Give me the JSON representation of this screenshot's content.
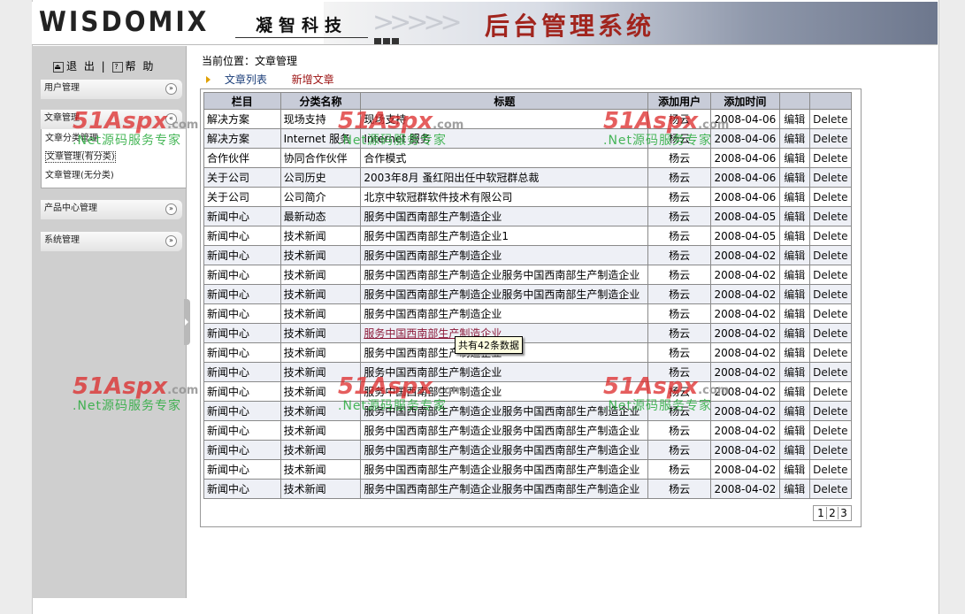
{
  "header": {
    "logo": "WISDOMIX",
    "logo_sub": "凝智科技",
    "title": "后台管理系统"
  },
  "sidebar": {
    "logout": "退 出",
    "help": "帮 助",
    "menus": [
      {
        "label": "用户管理"
      },
      {
        "label": "文章管理"
      },
      {
        "label": "产品中心管理"
      },
      {
        "label": "系统管理"
      }
    ],
    "article_sub": [
      "文章分类管理",
      "文章管理(有分类)",
      "文章管理(无分类)"
    ]
  },
  "main": {
    "breadcrumb": "当前位置：文章管理",
    "tab_list": "文章列表",
    "tab_add": "新增文章"
  },
  "table": {
    "headers": [
      "栏目",
      "分类名称",
      "标题",
      "添加用户",
      "添加时间",
      "",
      ""
    ],
    "edit_label": "编辑",
    "delete_label": "Delete",
    "rows": [
      [
        "解决方案",
        "现场支持",
        "现场支持",
        "杨云",
        "2008-04-06"
      ],
      [
        "解决方案",
        "Internet 服务",
        "Internet 服务",
        "杨云",
        "2008-04-06"
      ],
      [
        "合作伙伴",
        "协同合作伙伴",
        "合作模式",
        "杨云",
        "2008-04-06"
      ],
      [
        "关于公司",
        "公司历史",
        "2003年8月 蚤红阳出任中软冠群总裁",
        "杨云",
        "2008-04-06"
      ],
      [
        "关于公司",
        "公司简介",
        "北京中软冠群软件技术有限公司",
        "杨云",
        "2008-04-06"
      ],
      [
        "新闻中心",
        "最新动态",
        "服务中国西南部生产制造企业",
        "杨云",
        "2008-04-05"
      ],
      [
        "新闻中心",
        "技术新闻",
        "服务中国西南部生产制造企业1",
        "杨云",
        "2008-04-05"
      ],
      [
        "新闻中心",
        "技术新闻",
        "服务中国西南部生产制造企业",
        "杨云",
        "2008-04-02"
      ],
      [
        "新闻中心",
        "技术新闻",
        "服务中国西南部生产制造企业服务中国西南部生产制造企业",
        "杨云",
        "2008-04-02"
      ],
      [
        "新闻中心",
        "技术新闻",
        "服务中国西南部生产制造企业服务中国西南部生产制造企业",
        "杨云",
        "2008-04-02"
      ],
      [
        "新闻中心",
        "技术新闻",
        "服务中国西南部生产制造企业",
        "杨云",
        "2008-04-02"
      ],
      [
        "新闻中心",
        "技术新闻",
        "服务中国西南部生产制造企业",
        "杨云",
        "2008-04-02"
      ],
      [
        "新闻中心",
        "技术新闻",
        "服务中国西南部生产制造企业",
        "杨云",
        "2008-04-02"
      ],
      [
        "新闻中心",
        "技术新闻",
        "服务中国西南部生产制造企业",
        "杨云",
        "2008-04-02"
      ],
      [
        "新闻中心",
        "技术新闻",
        "服务中国西南部生产制造企业",
        "杨云",
        "2008-04-02"
      ],
      [
        "新闻中心",
        "技术新闻",
        "服务中国西南部生产制造企业服务中国西南部生产制造企业",
        "杨云",
        "2008-04-02"
      ],
      [
        "新闻中心",
        "技术新闻",
        "服务中国西南部生产制造企业服务中国西南部生产制造企业",
        "杨云",
        "2008-04-02"
      ],
      [
        "新闻中心",
        "技术新闻",
        "服务中国西南部生产制造企业服务中国西南部生产制造企业",
        "杨云",
        "2008-04-02"
      ],
      [
        "新闻中心",
        "技术新闻",
        "服务中国西南部生产制造企业服务中国西南部生产制造企业",
        "杨云",
        "2008-04-02"
      ],
      [
        "新闻中心",
        "技术新闻",
        "服务中国西南部生产制造企业服务中国西南部生产制造企业",
        "杨云",
        "2008-04-02"
      ]
    ],
    "pages": [
      "1",
      "2",
      "3"
    ]
  },
  "tooltip": "共有42条数据",
  "watermark": {
    "logo": "51Aspx",
    "domain": ".com",
    "slogan": ".Net源码服务专家"
  }
}
